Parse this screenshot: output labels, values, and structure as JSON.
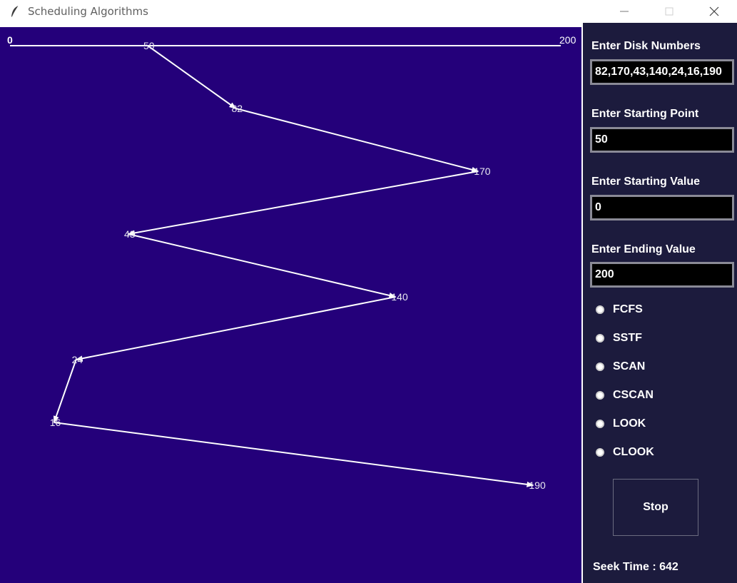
{
  "window": {
    "title": "Scheduling Algorithms"
  },
  "chart_data": {
    "type": "line",
    "xlim": [
      0,
      200
    ],
    "axis_labels": {
      "min": "0",
      "max": "200"
    },
    "start": 50,
    "sequence": [
      50,
      82,
      170,
      43,
      140,
      24,
      16,
      190
    ],
    "point_labels": [
      "50",
      "82",
      "170",
      "43",
      "140",
      "24",
      "16",
      "190"
    ],
    "grid": false,
    "colors": {
      "background": "#24007a",
      "line": "#ffffff"
    }
  },
  "panel": {
    "disk_numbers_label": "Enter Disk Numbers",
    "disk_numbers_value": "82,170,43,140,24,16,190",
    "starting_point_label": "Enter Starting Point",
    "starting_point_value": "50",
    "starting_value_label": "Enter Starting Value",
    "starting_value_value": "0",
    "ending_value_label": "Enter Ending Value",
    "ending_value_value": "200",
    "algorithms": [
      "FCFS",
      "SSTF",
      "SCAN",
      "CSCAN",
      "LOOK",
      "CLOOK"
    ],
    "stop_label": "Stop",
    "seek_time": "Seek Time : 642"
  },
  "icons": {
    "app": "feather-icon",
    "minimize": "minimize-icon",
    "maximize": "maximize-icon",
    "close": "close-icon"
  },
  "colors": {
    "panel_bg": "#1c1b3d",
    "canvas_bg": "#24007a",
    "text": "#ffffff"
  }
}
